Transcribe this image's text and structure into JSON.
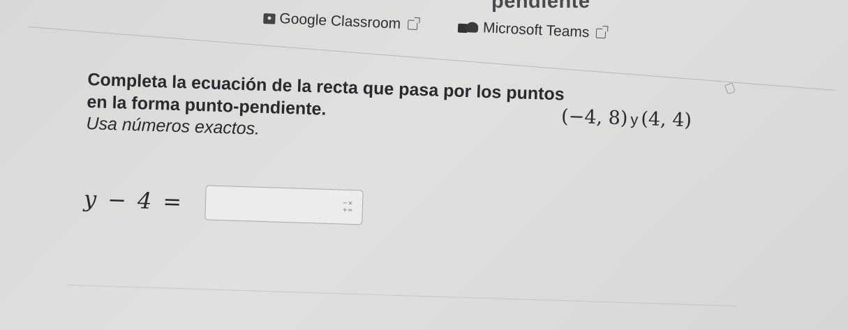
{
  "header": {
    "partial_title": "pendiente"
  },
  "links": [
    {
      "label": "Google Classroom",
      "icon": "google-classroom-icon"
    },
    {
      "label": "Microsoft Teams",
      "icon": "microsoft-teams-icon"
    }
  ],
  "question": {
    "prompt_line1": "Completa la ecuación de la recta que pasa por los puntos",
    "prompt_line2": "en la forma punto-pendiente.",
    "point1": "(−4, 8)",
    "connector": "y",
    "point2": "(4, 4)",
    "instruction": "Usa números exactos."
  },
  "answer": {
    "lhs_var": "y",
    "lhs_op": "−",
    "lhs_num": "4",
    "equals": "=",
    "value": "",
    "keypad_icon_label": "− ×\n+ ="
  }
}
